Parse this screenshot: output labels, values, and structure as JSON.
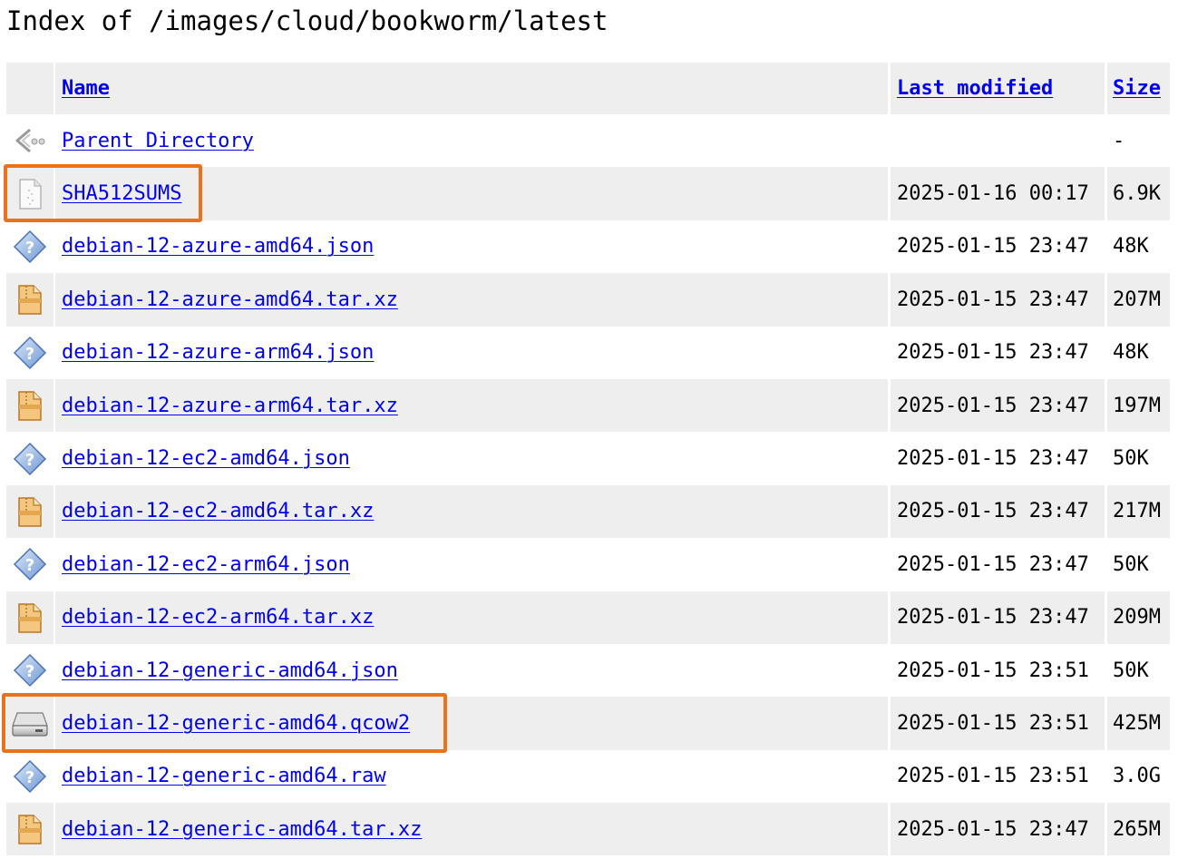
{
  "page": {
    "title": "Index of /images/cloud/bookworm/latest"
  },
  "columns": {
    "name": "Name",
    "last_modified": "Last modified",
    "size": "Size"
  },
  "rows": [
    {
      "name": "Parent Directory",
      "date": "",
      "size": "-",
      "icon": "back-icon"
    },
    {
      "name": "SHA512SUMS",
      "date": "2025-01-16 00:17",
      "size": "6.9K",
      "icon": "text-file-icon"
    },
    {
      "name": "debian-12-azure-amd64.json",
      "date": "2025-01-15 23:47",
      "size": "48K",
      "icon": "unknown-file-icon"
    },
    {
      "name": "debian-12-azure-amd64.tar.xz",
      "date": "2025-01-15 23:47",
      "size": "207M",
      "icon": "archive-icon"
    },
    {
      "name": "debian-12-azure-arm64.json",
      "date": "2025-01-15 23:47",
      "size": "48K",
      "icon": "unknown-file-icon"
    },
    {
      "name": "debian-12-azure-arm64.tar.xz",
      "date": "2025-01-15 23:47",
      "size": "197M",
      "icon": "archive-icon"
    },
    {
      "name": "debian-12-ec2-amd64.json",
      "date": "2025-01-15 23:47",
      "size": "50K",
      "icon": "unknown-file-icon"
    },
    {
      "name": "debian-12-ec2-amd64.tar.xz",
      "date": "2025-01-15 23:47",
      "size": "217M",
      "icon": "archive-icon"
    },
    {
      "name": "debian-12-ec2-arm64.json",
      "date": "2025-01-15 23:47",
      "size": "50K",
      "icon": "unknown-file-icon"
    },
    {
      "name": "debian-12-ec2-arm64.tar.xz",
      "date": "2025-01-15 23:47",
      "size": "209M",
      "icon": "archive-icon"
    },
    {
      "name": "debian-12-generic-amd64.json",
      "date": "2025-01-15 23:51",
      "size": "50K",
      "icon": "unknown-file-icon"
    },
    {
      "name": "debian-12-generic-amd64.qcow2",
      "date": "2025-01-15 23:51",
      "size": "425M",
      "icon": "disk-image-icon"
    },
    {
      "name": "debian-12-generic-amd64.raw",
      "date": "2025-01-15 23:51",
      "size": "3.0G",
      "icon": "unknown-file-icon"
    },
    {
      "name": "debian-12-generic-amd64.tar.xz",
      "date": "2025-01-15 23:47",
      "size": "265M",
      "icon": "archive-icon"
    }
  ],
  "highlights": [
    "SHA512SUMS",
    "debian-12-generic-amd64.qcow2"
  ],
  "colors": {
    "link": "#0000ee",
    "row_shade": "#eeeeee",
    "highlight_border": "#e8731a"
  }
}
